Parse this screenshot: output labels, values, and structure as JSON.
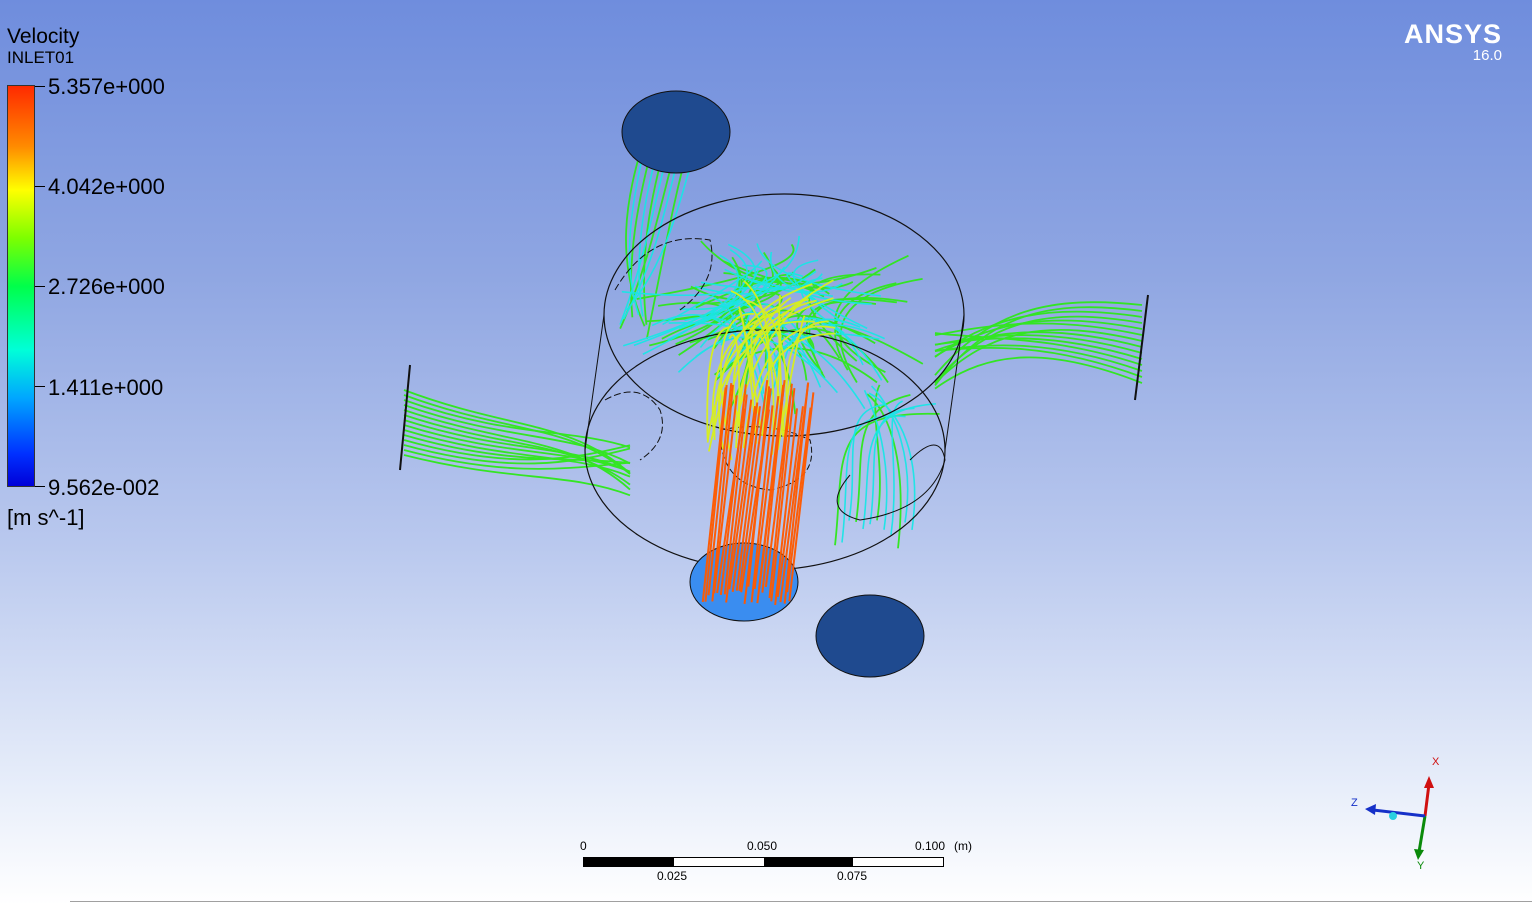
{
  "legend": {
    "variable": "Velocity",
    "location": "INLET01",
    "ticks": [
      "5.357e+000",
      "4.042e+000",
      "2.726e+000",
      "1.411e+000",
      "9.562e-002"
    ],
    "unit": "[m s^-1]"
  },
  "brand": {
    "name": "ANSYS",
    "version": "16.0"
  },
  "scale_bar": {
    "top_labels": [
      "0",
      "0.050",
      "0.100"
    ],
    "bottom_labels": [
      "0.025",
      "0.075"
    ],
    "unit": "(m)"
  },
  "axes_triad": {
    "x_label": "X",
    "y_label": "Y",
    "z_label": "Z"
  },
  "colors": {
    "background_top": "#6f8ddd",
    "background_bottom": "#ffffff",
    "port_face": "#1f4a8f",
    "inlet_face": "#3a8df0",
    "streamline_green": "#2ee81a",
    "streamline_cyan": "#19e6e6",
    "streamline_yellow": "#d9f01a",
    "streamline_orange": "#ff5a00"
  }
}
